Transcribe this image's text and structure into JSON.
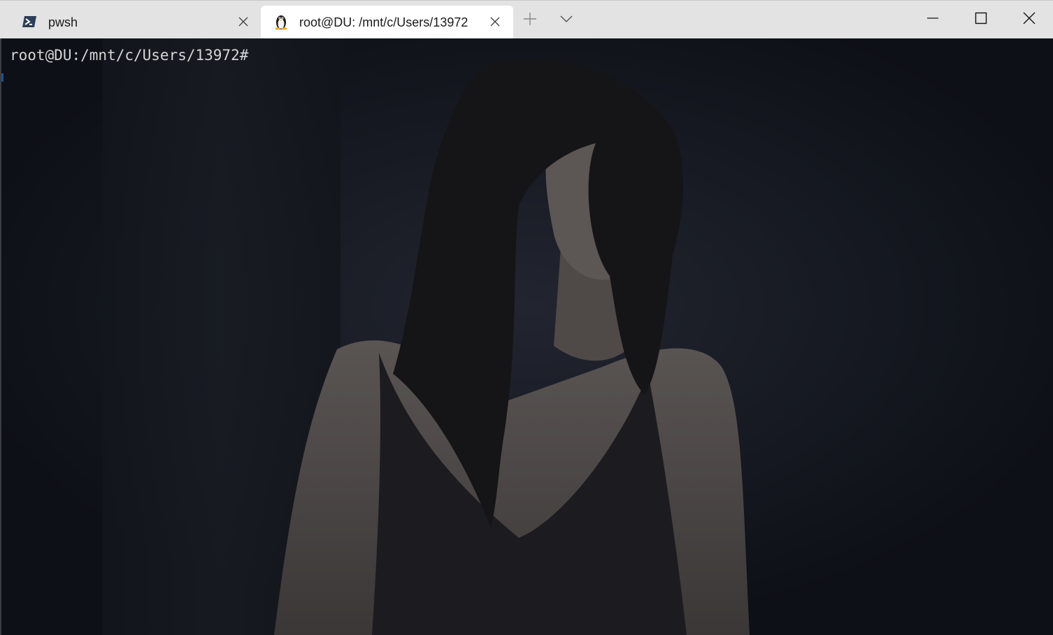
{
  "tabs": [
    {
      "title": "pwsh",
      "icon": "powershell-icon",
      "active": false
    },
    {
      "title": "root@DU: /mnt/c/Users/13972",
      "icon": "linux-penguin-icon",
      "active": true
    }
  ],
  "toolbar": {
    "new_tab_icon": "plus-icon",
    "dropdown_icon": "chevron-down-icon"
  },
  "window_controls": {
    "minimize_icon": "minimize-icon",
    "maximize_icon": "maximize-icon",
    "close_icon": "close-icon"
  },
  "terminal": {
    "prompt": "root@DU:/mnt/c/Users/13972#"
  },
  "colors": {
    "tab_bar": "#e3e3e3",
    "active_tab": "#ffffff",
    "terminal_background": "#0e1118",
    "prompt_text": "#d6d6d6"
  }
}
